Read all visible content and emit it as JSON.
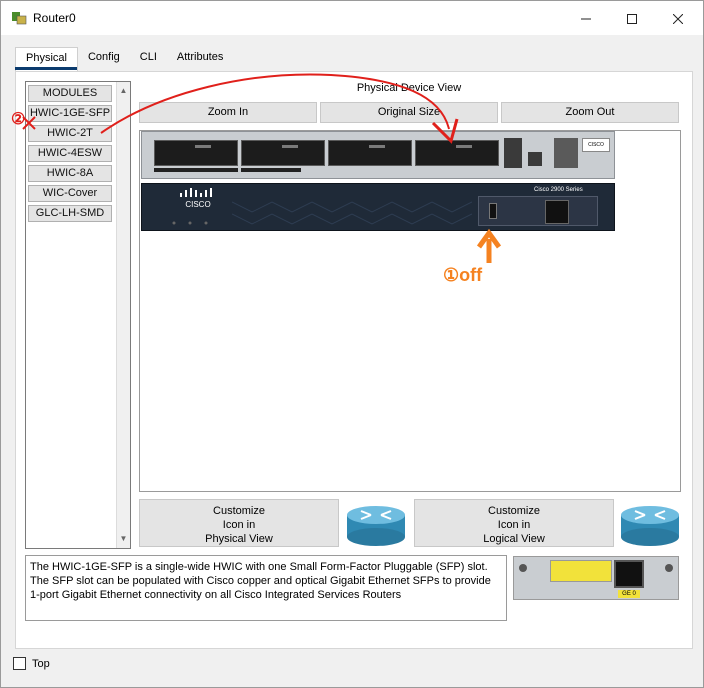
{
  "window": {
    "title": "Router0"
  },
  "tabs": [
    {
      "label": "Physical",
      "active": true
    },
    {
      "label": "Config",
      "active": false
    },
    {
      "label": "CLI",
      "active": false
    },
    {
      "label": "Attributes",
      "active": false
    }
  ],
  "modules": {
    "header": "MODULES",
    "items": [
      "HWIC-1GE-SFP",
      "HWIC-2T",
      "HWIC-4ESW",
      "HWIC-8A",
      "WIC-Cover",
      "GLC-LH-SMD"
    ]
  },
  "physical_view": {
    "title": "Physical Device View",
    "zoom_in": "Zoom In",
    "original_size": "Original Size",
    "zoom_out": "Zoom Out",
    "router_model": "Cisco 2900 Series",
    "brand": "CISCO"
  },
  "customize": {
    "physical_line1": "Customize",
    "physical_line2": "Icon in",
    "physical_line3": "Physical View",
    "logical_line1": "Customize",
    "logical_line2": "Icon in",
    "logical_line3": "Logical View"
  },
  "description": "The HWIC-1GE-SFP is a single-wide HWIC with one Small Form-Factor Pluggable (SFP) slot. The SFP slot can be populated with Cisco copper and optical Gigabit Ethernet SFPs to provide 1-port Gigabit Ethernet connectivity on all Cisco Integrated Services Routers",
  "module_image_label": "GE 0",
  "top_checkbox_label": "Top",
  "annotations": {
    "step1": "①off",
    "step2": "②"
  },
  "colors": {
    "tab_accent": "#0b3b6e",
    "annotation_red": "#e0201b",
    "annotation_orange": "#f58220"
  }
}
